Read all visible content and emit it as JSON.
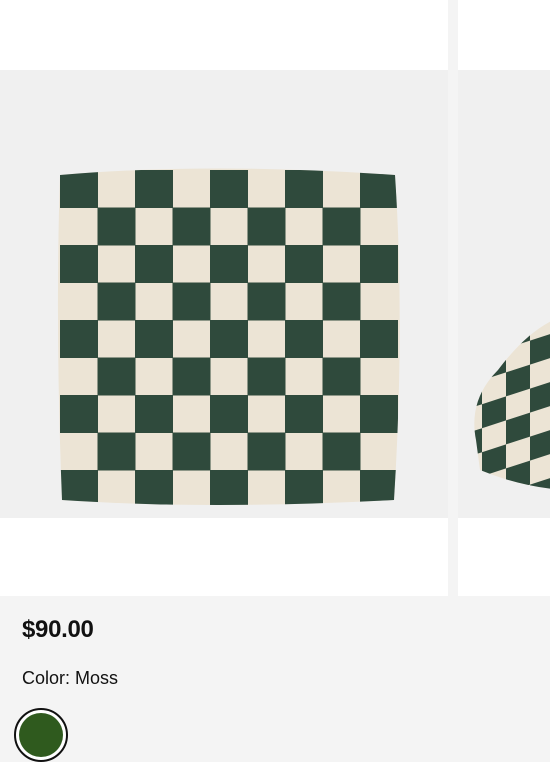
{
  "product": {
    "price": "$90.00",
    "color_label": "Color:",
    "color_value": "Moss",
    "swatch_color": "#2f5a1e"
  },
  "pillow": {
    "dark_color": "#2f4a3c",
    "light_color": "#ece4d5"
  },
  "colors": {
    "page_background": "#f4f4f4",
    "slide_background": "#ffffff",
    "photo_background": "#f0f0f0"
  }
}
